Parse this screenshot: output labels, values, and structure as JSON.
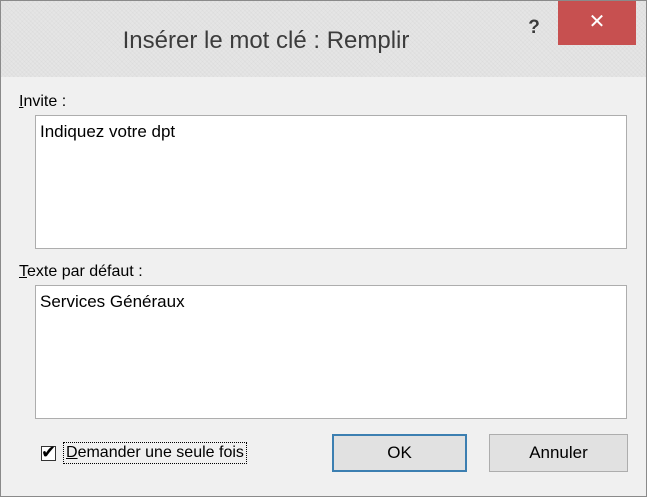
{
  "dialog": {
    "title": "Insérer le mot clé : Remplir",
    "help_label": "?",
    "close_label": "✕"
  },
  "prompt": {
    "label_accel": "I",
    "label_rest": "nvite :",
    "value": "Indiquez votre dpt"
  },
  "default_text": {
    "label_accel": "T",
    "label_rest": "exte par défaut :",
    "value": "Services Généraux"
  },
  "ask_once": {
    "checked": true,
    "check_glyph": "✔",
    "label_accel": "D",
    "label_rest": "emander une seule fois"
  },
  "buttons": {
    "ok_label": "OK",
    "cancel_label": "Annuler"
  },
  "colors": {
    "close_button": "#c75050",
    "default_button_border": "#3c7fb1",
    "window_background": "#f0f0f0"
  }
}
